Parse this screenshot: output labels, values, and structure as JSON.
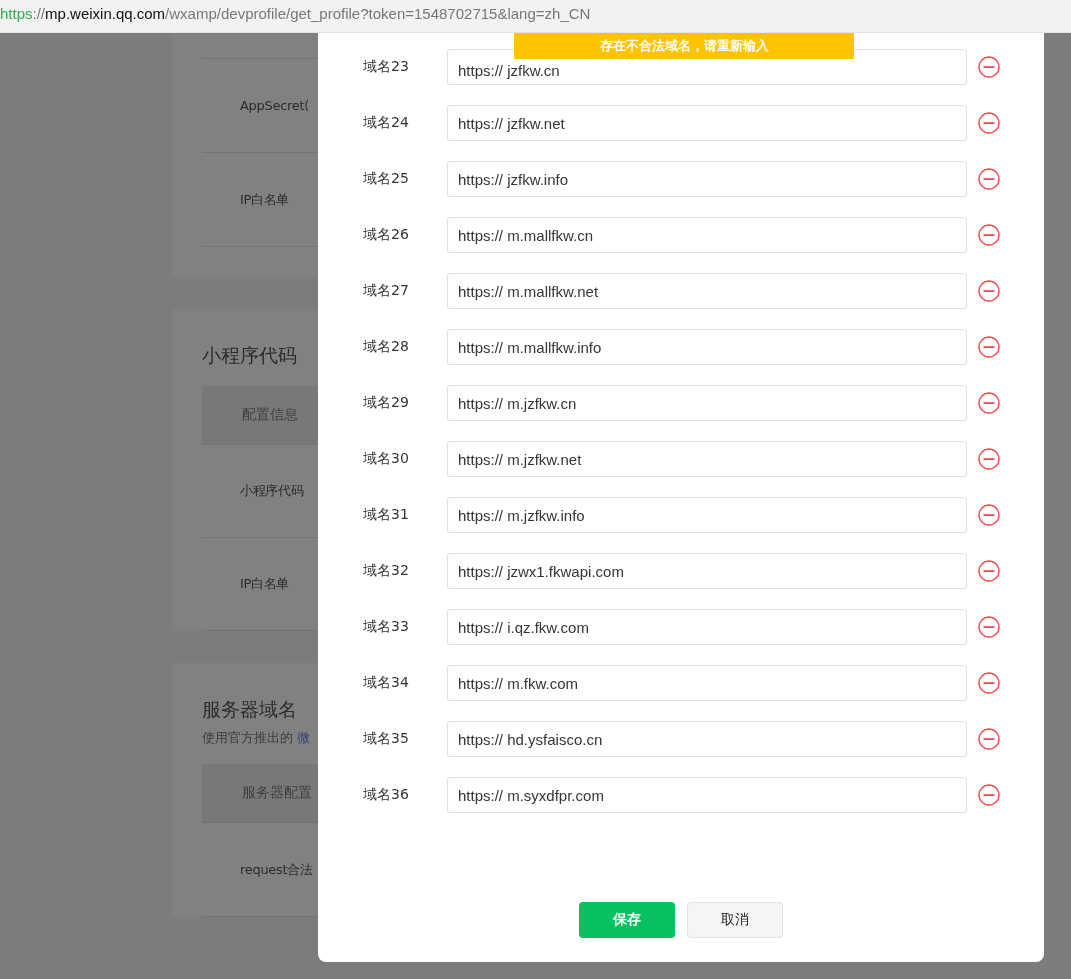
{
  "address_bar": {
    "scheme": "https",
    "separator": "://",
    "host": "mp.weixin.qq.com",
    "path": "/wxamp/devprofile/get_profile?token=1548702715&lang=zh_CN"
  },
  "background_cards": [
    {
      "rows": [
        {
          "kind": "row",
          "label": "AppSecret("
        },
        {
          "kind": "row",
          "label": "IP白名单"
        }
      ]
    },
    {
      "title": "小程序代码",
      "rows": [
        {
          "kind": "header",
          "label": "配置信息"
        },
        {
          "kind": "row",
          "label": "小程序代码"
        },
        {
          "kind": "row",
          "label": "IP白名单"
        }
      ]
    },
    {
      "title": "服务器域名",
      "subtitle": "使用官方推出的",
      "subtitle_link": "微",
      "rows": [
        {
          "kind": "header",
          "label": "服务器配置"
        },
        {
          "kind": "row",
          "label": "request合法"
        }
      ]
    }
  ],
  "dialog": {
    "toast": "存在不合法域名，请重新输入",
    "domains": [
      {
        "label": "域名23",
        "value": "https:// jzfkw.cn"
      },
      {
        "label": "域名24",
        "value": "https:// jzfkw.net"
      },
      {
        "label": "域名25",
        "value": "https:// jzfkw.info"
      },
      {
        "label": "域名26",
        "value": "https:// m.mallfkw.cn"
      },
      {
        "label": "域名27",
        "value": "https:// m.mallfkw.net"
      },
      {
        "label": "域名28",
        "value": "https:// m.mallfkw.info"
      },
      {
        "label": "域名29",
        "value": "https:// m.jzfkw.cn"
      },
      {
        "label": "域名30",
        "value": "https:// m.jzfkw.net"
      },
      {
        "label": "域名31",
        "value": "https:// m.jzfkw.info"
      },
      {
        "label": "域名32",
        "value": "https:// jzwx1.fkwapi.com"
      },
      {
        "label": "域名33",
        "value": "https:// i.qz.fkw.com"
      },
      {
        "label": "域名34",
        "value": "https:// m.fkw.com"
      },
      {
        "label": "域名35",
        "value": "https:// hd.ysfaisco.cn"
      },
      {
        "label": "域名36",
        "value": "https:// m.syxdfpr.com"
      }
    ],
    "buttons": [
      {
        "kind": "primary",
        "label": "保存"
      },
      {
        "kind": "default",
        "label": "取消"
      }
    ]
  }
}
